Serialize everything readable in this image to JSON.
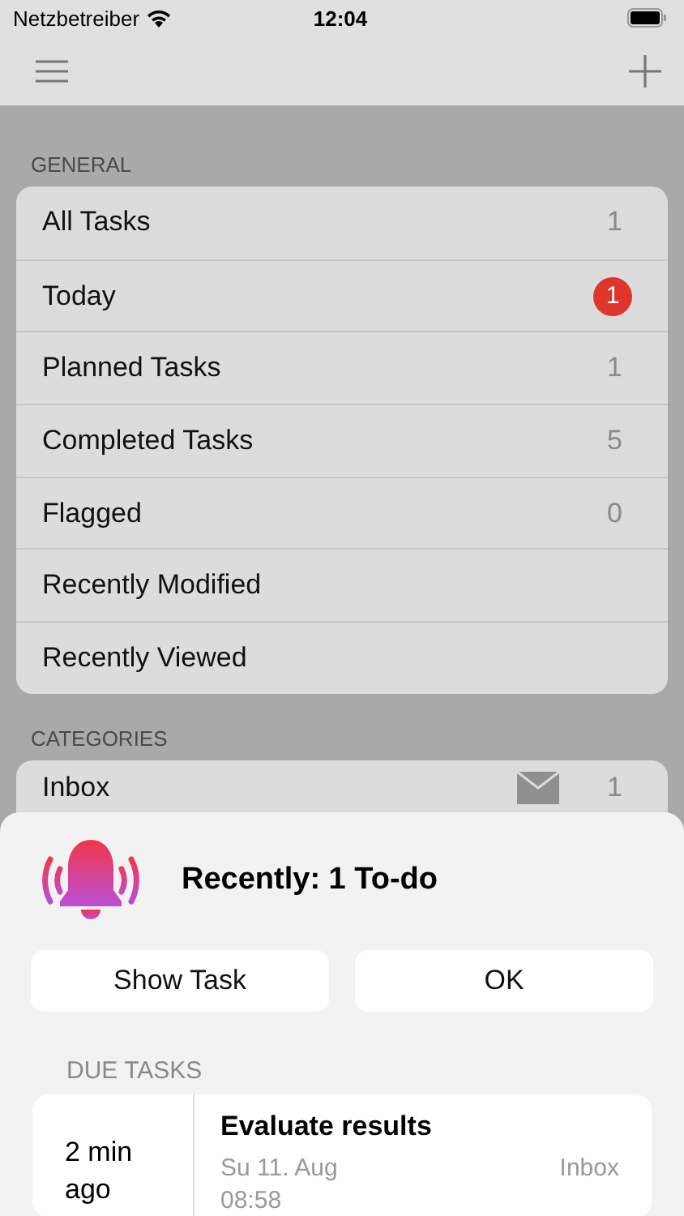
{
  "status_bar": {
    "carrier": "Netzbetreiber",
    "time": "12:04"
  },
  "sections": [
    {
      "title": "GENERAL",
      "items": [
        {
          "label": "All Tasks",
          "count": "1",
          "kind": "plain"
        },
        {
          "label": "Today",
          "count": "1",
          "kind": "badge"
        },
        {
          "label": "Planned Tasks",
          "count": "1",
          "kind": "plain"
        },
        {
          "label": "Completed Tasks",
          "count": "5",
          "kind": "plain"
        },
        {
          "label": "Flagged",
          "count": "0",
          "kind": "plain"
        },
        {
          "label": "Recently Modified",
          "kind": "plain"
        },
        {
          "label": "Recently Viewed",
          "kind": "plain"
        }
      ]
    },
    {
      "title": "CATEGORIES",
      "items": [
        {
          "label": "Inbox",
          "count": "1",
          "kind": "mail"
        }
      ]
    }
  ],
  "sheet": {
    "title": "Recently: 1 To-do",
    "buttons": [
      "Show Task",
      "OK"
    ],
    "due_title": "DUE TASKS",
    "tasks": [
      {
        "when": "2 min ago",
        "title": "Evaluate results",
        "date": "Su 11. Aug 08:58",
        "category": "Inbox"
      }
    ]
  }
}
